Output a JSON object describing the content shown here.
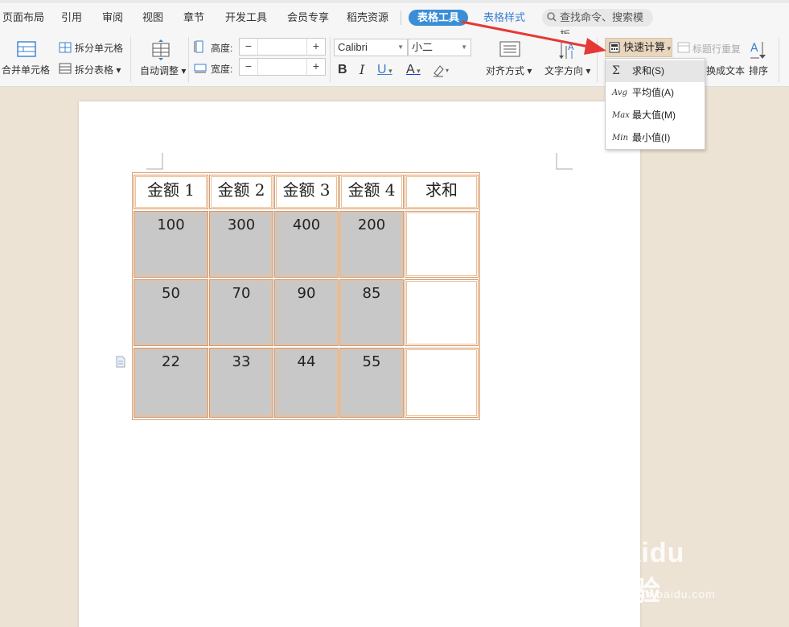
{
  "tabs": {
    "items": [
      "页面布局",
      "引用",
      "审阅",
      "视图",
      "章节",
      "开发工具",
      "会员专享",
      "稻壳资源"
    ],
    "active": "表格工具",
    "style_tab": "表格样式",
    "search_placeholder": "查找命令、搜索模板"
  },
  "ribbon": {
    "merge_cells": "合并单元格",
    "split_cells": "拆分单元格",
    "split_table": "拆分表格",
    "auto_fit": "自动调整",
    "height_label": "高度:",
    "width_label": "宽度:",
    "height_value": "",
    "width_value": "",
    "font_name": "Calibri",
    "font_size": "小二",
    "bold": "B",
    "italic": "I",
    "underline": "U",
    "font_color": "A",
    "align": "对齐方式",
    "text_direction": "文字方向",
    "quick_calc": "快速计算",
    "title_repeat": "标题行重复",
    "convert_text": "换成文本",
    "sort": "排序"
  },
  "quick_calc_menu": [
    {
      "icon": "Σ",
      "label": "求和(S)"
    },
    {
      "icon": "Avg",
      "label": "平均值(A)"
    },
    {
      "icon": "Max",
      "label": "最大值(M)"
    },
    {
      "icon": "Min",
      "label": "最小值(I)"
    }
  ],
  "table": {
    "headers": [
      "金额 1",
      "金额 2",
      "金额 3",
      "金额 4",
      "求和"
    ],
    "rows": [
      [
        "100",
        "300",
        "400",
        "200",
        ""
      ],
      [
        "50",
        "70",
        "90",
        "85",
        ""
      ],
      [
        "22",
        "33",
        "44",
        "55",
        ""
      ]
    ]
  },
  "watermark": {
    "brand": "Baidu经验",
    "url": "jingyan.baidu.com"
  },
  "colors": {
    "accent": "#3a8ed6",
    "arrow": "#e53935",
    "cell_fill": "#c8c8c8",
    "cell_border": "#d4966a"
  }
}
